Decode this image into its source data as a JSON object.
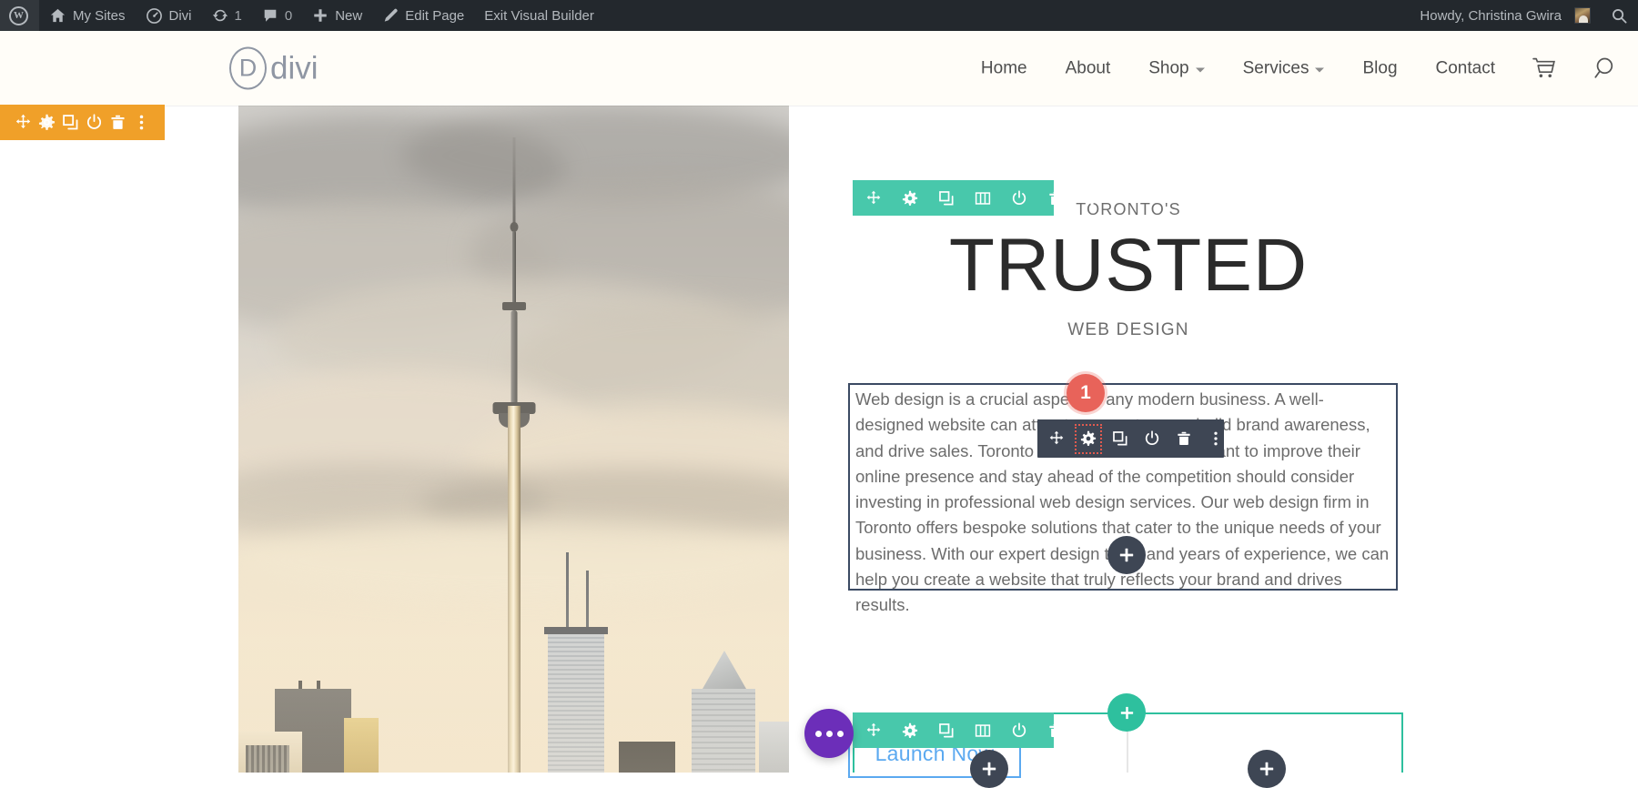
{
  "admin_bar": {
    "items": [
      {
        "name": "wp-logo",
        "label": "",
        "icon": "wordpress-icon"
      },
      {
        "name": "my-sites",
        "label": "My Sites",
        "icon": "sites-icon"
      },
      {
        "name": "site-name",
        "label": "Divi",
        "icon": "dashboard-icon"
      },
      {
        "name": "updates",
        "label": "1",
        "icon": "updates-icon"
      },
      {
        "name": "comments",
        "label": "0",
        "icon": "comment-bubble-icon"
      },
      {
        "name": "new-content",
        "label": "New",
        "icon": "plus-icon"
      },
      {
        "name": "edit-page",
        "label": "Edit Page",
        "icon": "pencil-icon"
      },
      {
        "name": "exit-visual-builder",
        "label": "Exit Visual Builder",
        "icon": ""
      }
    ],
    "account": {
      "greeting": "Howdy, Christina Gwira",
      "avatar_name": "user-avatar"
    },
    "search_icon": "search-icon",
    "bg_color": "#23282d",
    "text_color": "#b4b9be"
  },
  "site_header": {
    "logo": {
      "mark": "D",
      "word": "divi"
    },
    "nav": [
      {
        "label": "Home",
        "has_dropdown": false
      },
      {
        "label": "About",
        "has_dropdown": false
      },
      {
        "label": "Shop",
        "has_dropdown": true
      },
      {
        "label": "Services",
        "has_dropdown": true
      },
      {
        "label": "Blog",
        "has_dropdown": false
      },
      {
        "label": "Contact",
        "has_dropdown": false
      }
    ],
    "cart_icon": "shopping-cart-icon",
    "search_icon": "search-icon",
    "bg_color": "#fffdf8"
  },
  "builder": {
    "section_toolbar": {
      "color": "#f0a029",
      "buttons": [
        "move-icon",
        "settings-gear-icon",
        "duplicate-icon",
        "disable-icon",
        "delete-icon",
        "more-options-icon"
      ]
    },
    "row_toolbar": {
      "color": "#48c8ab",
      "buttons": [
        "move-icon",
        "settings-gear-icon",
        "duplicate-icon",
        "column-structure-icon",
        "disable-icon",
        "delete-icon",
        "more-options-icon"
      ]
    },
    "module_toolbar": {
      "color": "#3e4654",
      "highlight_color": "#e05a4f",
      "highlighted_button": "settings-gear-icon",
      "buttons": [
        "move-icon",
        "settings-gear-icon",
        "duplicate-icon",
        "disable-icon",
        "delete-icon",
        "more-options-icon"
      ]
    },
    "step_badge": {
      "number": "1",
      "color": "#e8635a"
    },
    "add_module_label": "+",
    "add_row_label": "+",
    "page_settings_fab": {
      "name": "page-settings-button",
      "color": "#6c2eb9"
    },
    "selected_module_border_color": "#3b4a63",
    "row_outline_color": "#2ec09e"
  },
  "hero": {
    "image_alt": "Toronto CN Tower skyline",
    "eyebrow": "TORONTO'S",
    "title": "TRUSTED",
    "subtitle": "WEB DESIGN",
    "paragraph": "Web design is a crucial aspect of any modern business. A well-designed website can attract new customers, build brand awareness, and drive sales. Toronto business owners who want to improve their online presence and stay ahead of the competition should consider investing in professional web design services. Our web design firm in Toronto offers bespoke solutions that cater to the unique needs of your business. With our expert design team and years of experience, we can help you create a website that truly reflects your brand and drives results.",
    "cta_label": "Launch Now",
    "cta_color": "#5ba9f0"
  }
}
